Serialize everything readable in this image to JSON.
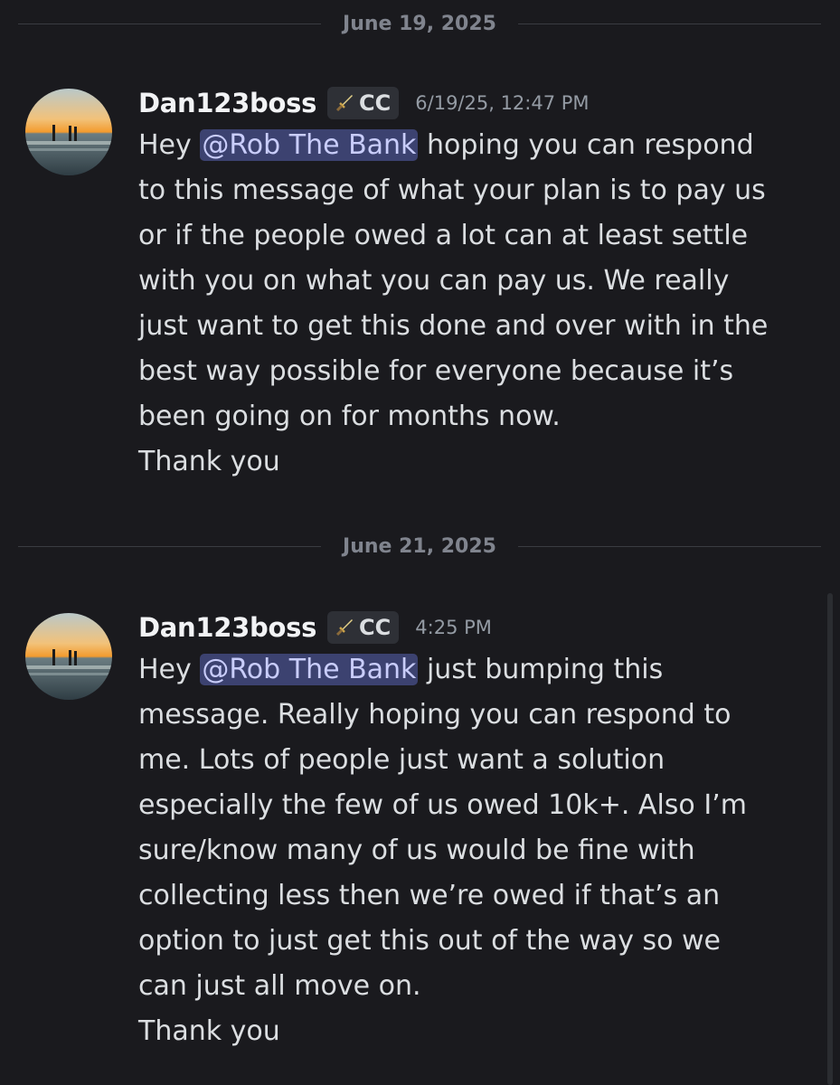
{
  "dividers": {
    "first": "June 19, 2025",
    "second": "June 21, 2025"
  },
  "messages": [
    {
      "username": "Dan123boss",
      "tag": "CC",
      "timestamp": "6/19/25, 12:47 PM",
      "mention": "@Rob The Bank",
      "lines": [
        {
          "before": "Hey ",
          "after": " hoping you can respond"
        },
        "to this message of what your plan is to pay us",
        "or if the people owed a lot can at least settle",
        "with you on what you can pay us. We really",
        "just want to  get this done and over with in the",
        "best way possible for everyone because it’s",
        "been going on for months now.",
        "Thank you"
      ]
    },
    {
      "username": "Dan123boss",
      "tag": "CC",
      "timestamp": "4:25 PM",
      "mention": "@Rob The Bank",
      "lines": [
        {
          "before": "Hey ",
          "after": " just bumping this"
        },
        "message. Really hoping you can respond to",
        "me. Lots of people just want a solution",
        "especially the few of us owed 10k+. Also I’m",
        "sure/know many of us would be fine with",
        "collecting less then we’re owed if that’s an",
        "option to just get this out of the way so we",
        "can just all move on.",
        "Thank you"
      ]
    }
  ],
  "colors": {
    "background": "#1a1a1e",
    "mention_bg": "#3c4270",
    "mention_text": "#c9cdfb"
  },
  "icons": {
    "avatar": "beach-sunset-avatar",
    "tag_icon": "sword-icon"
  }
}
